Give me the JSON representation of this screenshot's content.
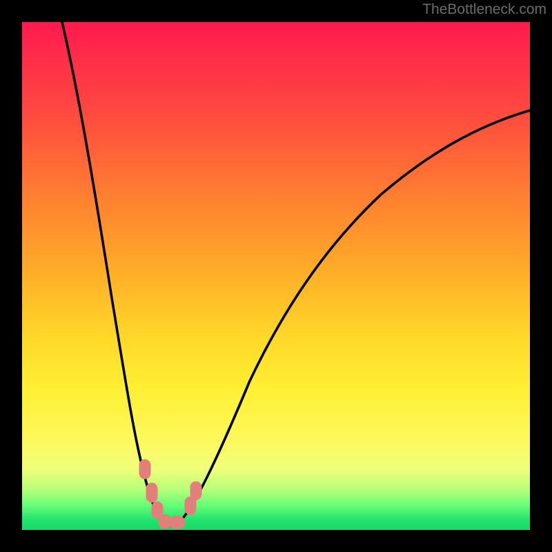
{
  "watermark": {
    "text": "TheBottleneck.com"
  },
  "colors": {
    "frame_border": "#000000",
    "curve_stroke": "#000000",
    "marker_fill": "#e37f7a",
    "gradient_top": "#ff1a4d",
    "gradient_bottom": "#17d968"
  },
  "chart_data": {
    "type": "line",
    "title": "",
    "xlabel": "",
    "ylabel": "",
    "xlim": [
      0,
      100
    ],
    "ylim": [
      0,
      100
    ],
    "grid": false,
    "note": "Qualitative bottleneck curve. No axis ticks or numeric data labels are visible in the image; x/y values are estimated from pixel positions on a 0–100 scale where y=100 is top (red / high bottleneck) and y=0 is bottom (green / balanced).",
    "series": [
      {
        "name": "bottleneck-curve",
        "x": [
          8,
          12,
          16,
          20,
          23,
          25,
          27,
          29,
          32,
          36,
          43,
          52,
          62,
          75,
          90,
          100
        ],
        "y": [
          100,
          82,
          60,
          38,
          20,
          9,
          2,
          1,
          4,
          16,
          36,
          52,
          64,
          74,
          80,
          82
        ]
      }
    ],
    "markers": [
      {
        "name": "trough-marker-1",
        "x": 24.0,
        "y": 13
      },
      {
        "name": "trough-marker-2",
        "x": 25.5,
        "y": 8
      },
      {
        "name": "trough-marker-3",
        "x": 26.5,
        "y": 4
      },
      {
        "name": "trough-marker-4",
        "x": 27.5,
        "y": 1.5
      },
      {
        "name": "trough-marker-5",
        "x": 29.5,
        "y": 1.5
      },
      {
        "name": "trough-marker-6",
        "x": 32.5,
        "y": 5.5
      },
      {
        "name": "trough-marker-7",
        "x": 33.5,
        "y": 8.5
      }
    ]
  }
}
